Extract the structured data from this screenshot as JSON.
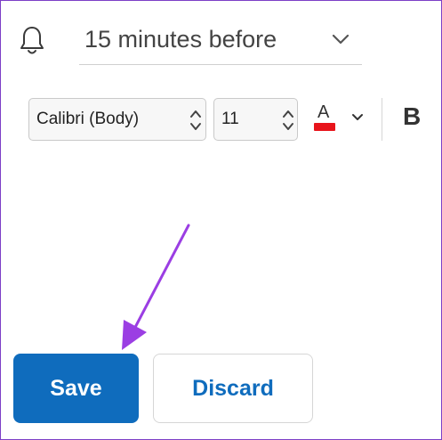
{
  "reminder": {
    "icon": "bell-icon",
    "value": "15 minutes before",
    "chevron_icon": "chevron-down-icon"
  },
  "toolbar": {
    "font_name": "Calibri (Body)",
    "font_size": "11",
    "font_color_letter": "A",
    "font_color": "#e8141b",
    "bold_label": "B"
  },
  "actions": {
    "save_label": "Save",
    "discard_label": "Discard"
  },
  "colors": {
    "accent": "#0f6cbd",
    "annotation_arrow": "#9b3ee3",
    "border": "#7d3fc7"
  }
}
